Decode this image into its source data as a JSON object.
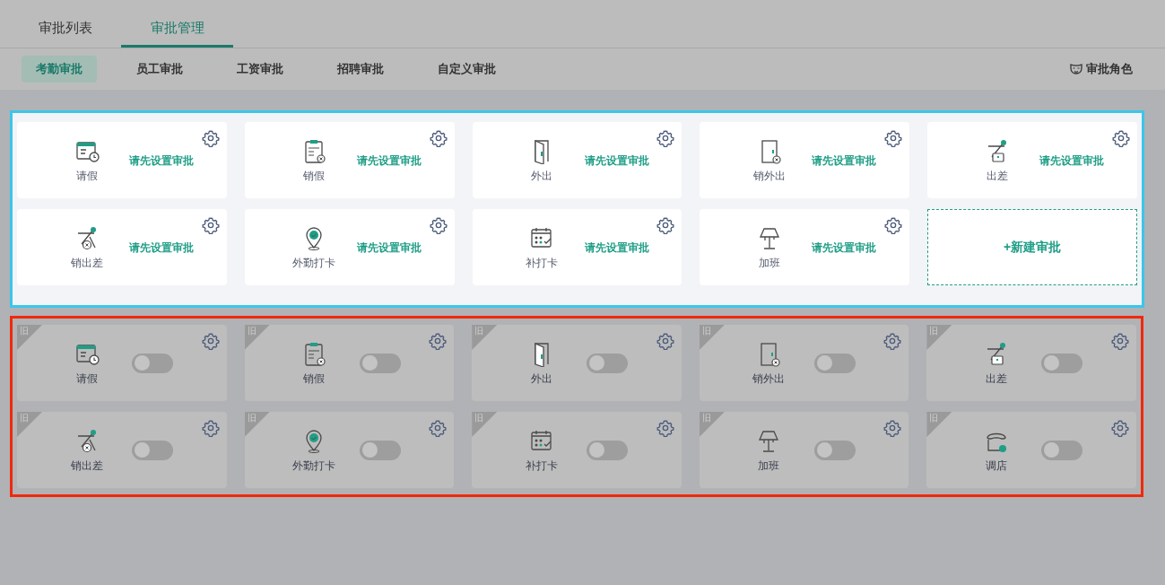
{
  "tabs": [
    {
      "label": "审批列表",
      "selected": false
    },
    {
      "label": "审批管理",
      "selected": true
    }
  ],
  "subtabs": [
    {
      "label": "考勤审批",
      "selected": true
    },
    {
      "label": "员工审批",
      "selected": false
    },
    {
      "label": "工资审批",
      "selected": false
    },
    {
      "label": "招聘审批",
      "selected": false
    },
    {
      "label": "自定义审批",
      "selected": false
    }
  ],
  "role_button": "审批角色",
  "new_group": {
    "cards": [
      {
        "kind": "leave",
        "name": "请假",
        "status": "请先设置审批"
      },
      {
        "kind": "cancel-leave",
        "name": "销假",
        "status": "请先设置审批"
      },
      {
        "kind": "out",
        "name": "外出",
        "status": "请先设置审批"
      },
      {
        "kind": "cancel-out",
        "name": "销外出",
        "status": "请先设置审批"
      },
      {
        "kind": "trip",
        "name": "出差",
        "status": "请先设置审批"
      },
      {
        "kind": "cancel-trip",
        "name": "销出差",
        "status": "请先设置审批"
      },
      {
        "kind": "checkin",
        "name": "外勤打卡",
        "status": "请先设置审批"
      },
      {
        "kind": "punch",
        "name": "补打卡",
        "status": "请先设置审批"
      },
      {
        "kind": "overtime",
        "name": "加班",
        "status": "请先设置审批"
      }
    ],
    "add_button": "+新建审批"
  },
  "old_group": {
    "cards": [
      {
        "kind": "leave",
        "name": "请假",
        "badge": "旧",
        "on": false
      },
      {
        "kind": "cancel-leave",
        "name": "销假",
        "badge": "旧",
        "on": false
      },
      {
        "kind": "out",
        "name": "外出",
        "badge": "旧",
        "on": false
      },
      {
        "kind": "cancel-out",
        "name": "销外出",
        "badge": "旧",
        "on": false
      },
      {
        "kind": "trip",
        "name": "出差",
        "badge": "旧",
        "on": false
      },
      {
        "kind": "cancel-trip",
        "name": "销出差",
        "badge": "旧",
        "on": false
      },
      {
        "kind": "checkin",
        "name": "外勤打卡",
        "badge": "旧",
        "on": false
      },
      {
        "kind": "punch",
        "name": "补打卡",
        "badge": "旧",
        "on": false
      },
      {
        "kind": "overtime",
        "name": "加班",
        "badge": "旧",
        "on": false
      },
      {
        "kind": "store",
        "name": "调店",
        "badge": "旧",
        "on": false
      }
    ]
  }
}
